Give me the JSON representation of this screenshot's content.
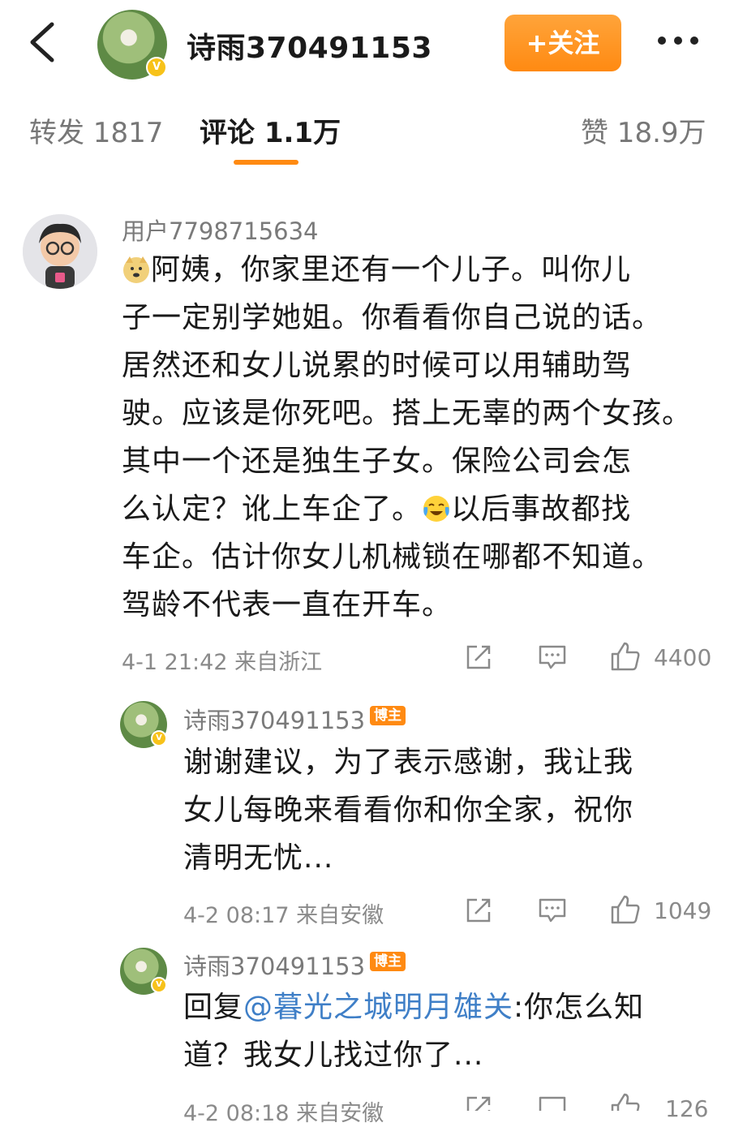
{
  "header": {
    "username": "诗雨370491153",
    "follow_label": "+关注"
  },
  "tabs": [
    {
      "label": "转发 1817"
    },
    {
      "label": "评论 1.1万"
    },
    {
      "label": "赞 18.9万"
    }
  ],
  "comment": {
    "username": "用户7798715634",
    "text_part1": "阿姨，你家里还有一个儿子。叫你儿",
    "lines": [
      "子一定别学她姐。你看看你自己说的话。",
      "居然还和女儿说累的时候可以用辅助驾",
      "驶。应该是你死吧。搭上无辜的两个女孩。",
      "其中一个还是独生子女。保险公司会怎"
    ],
    "line6_part1": "么认定？讹上车企了。",
    "line6_part2": "以后事故都找",
    "lines_after": [
      "车企。估计你女儿机械锁在哪都不知道。",
      "驾龄不代表一直在开车。"
    ],
    "meta": "4-1 21:42 来自浙江",
    "like_count": "4400",
    "emoji1": "doge-emoji",
    "emoji2": "laugh-cry-emoji"
  },
  "replies": [
    {
      "username": "诗雨370491153",
      "tag": "博主",
      "lines": [
        "谢谢建议，为了表示感谢，我让我",
        "女儿每晚来看看你和你全家，祝你",
        "清明无忧..."
      ],
      "meta": "4-2 08:17 来自安徽",
      "like_count": "1049"
    },
    {
      "username": "诗雨370491153",
      "tag": "博主",
      "reply_prefix": "回复",
      "mention": "@暮光之城明月雄关",
      "line1_rest": ":你怎么知",
      "line2": "道？我女儿找过你了...",
      "meta": "4-2 08:18 来自安徽",
      "like_count": "126"
    }
  ],
  "colors": {
    "accent": "#ff8a12",
    "mention": "#3f7fc7",
    "vip_badge": "#f7c21a"
  }
}
